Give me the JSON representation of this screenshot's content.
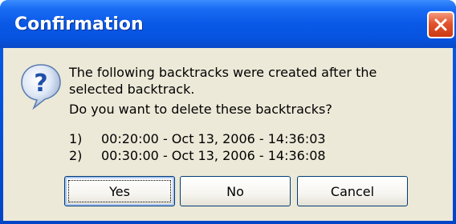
{
  "dialog": {
    "title": "Confirmation",
    "close_icon": "close-x-icon",
    "message_icon": "question-icon",
    "message_line1": "The following backtracks were created after the",
    "message_line2": "selected backtrack.",
    "question": "Do you want to delete these backtracks?",
    "backtracks": [
      {
        "num": "1)",
        "text": "00:20:00 - Oct 13, 2006 - 14:36:03"
      },
      {
        "num": "2)",
        "text": "00:30:00 - Oct 13, 2006 - 14:36:08"
      }
    ],
    "buttons": {
      "yes": "Yes",
      "no": "No",
      "cancel": "Cancel"
    }
  },
  "colors": {
    "titlebar": "#0553df",
    "client_bg": "#ece9d8",
    "close_button": "#e2542d"
  }
}
